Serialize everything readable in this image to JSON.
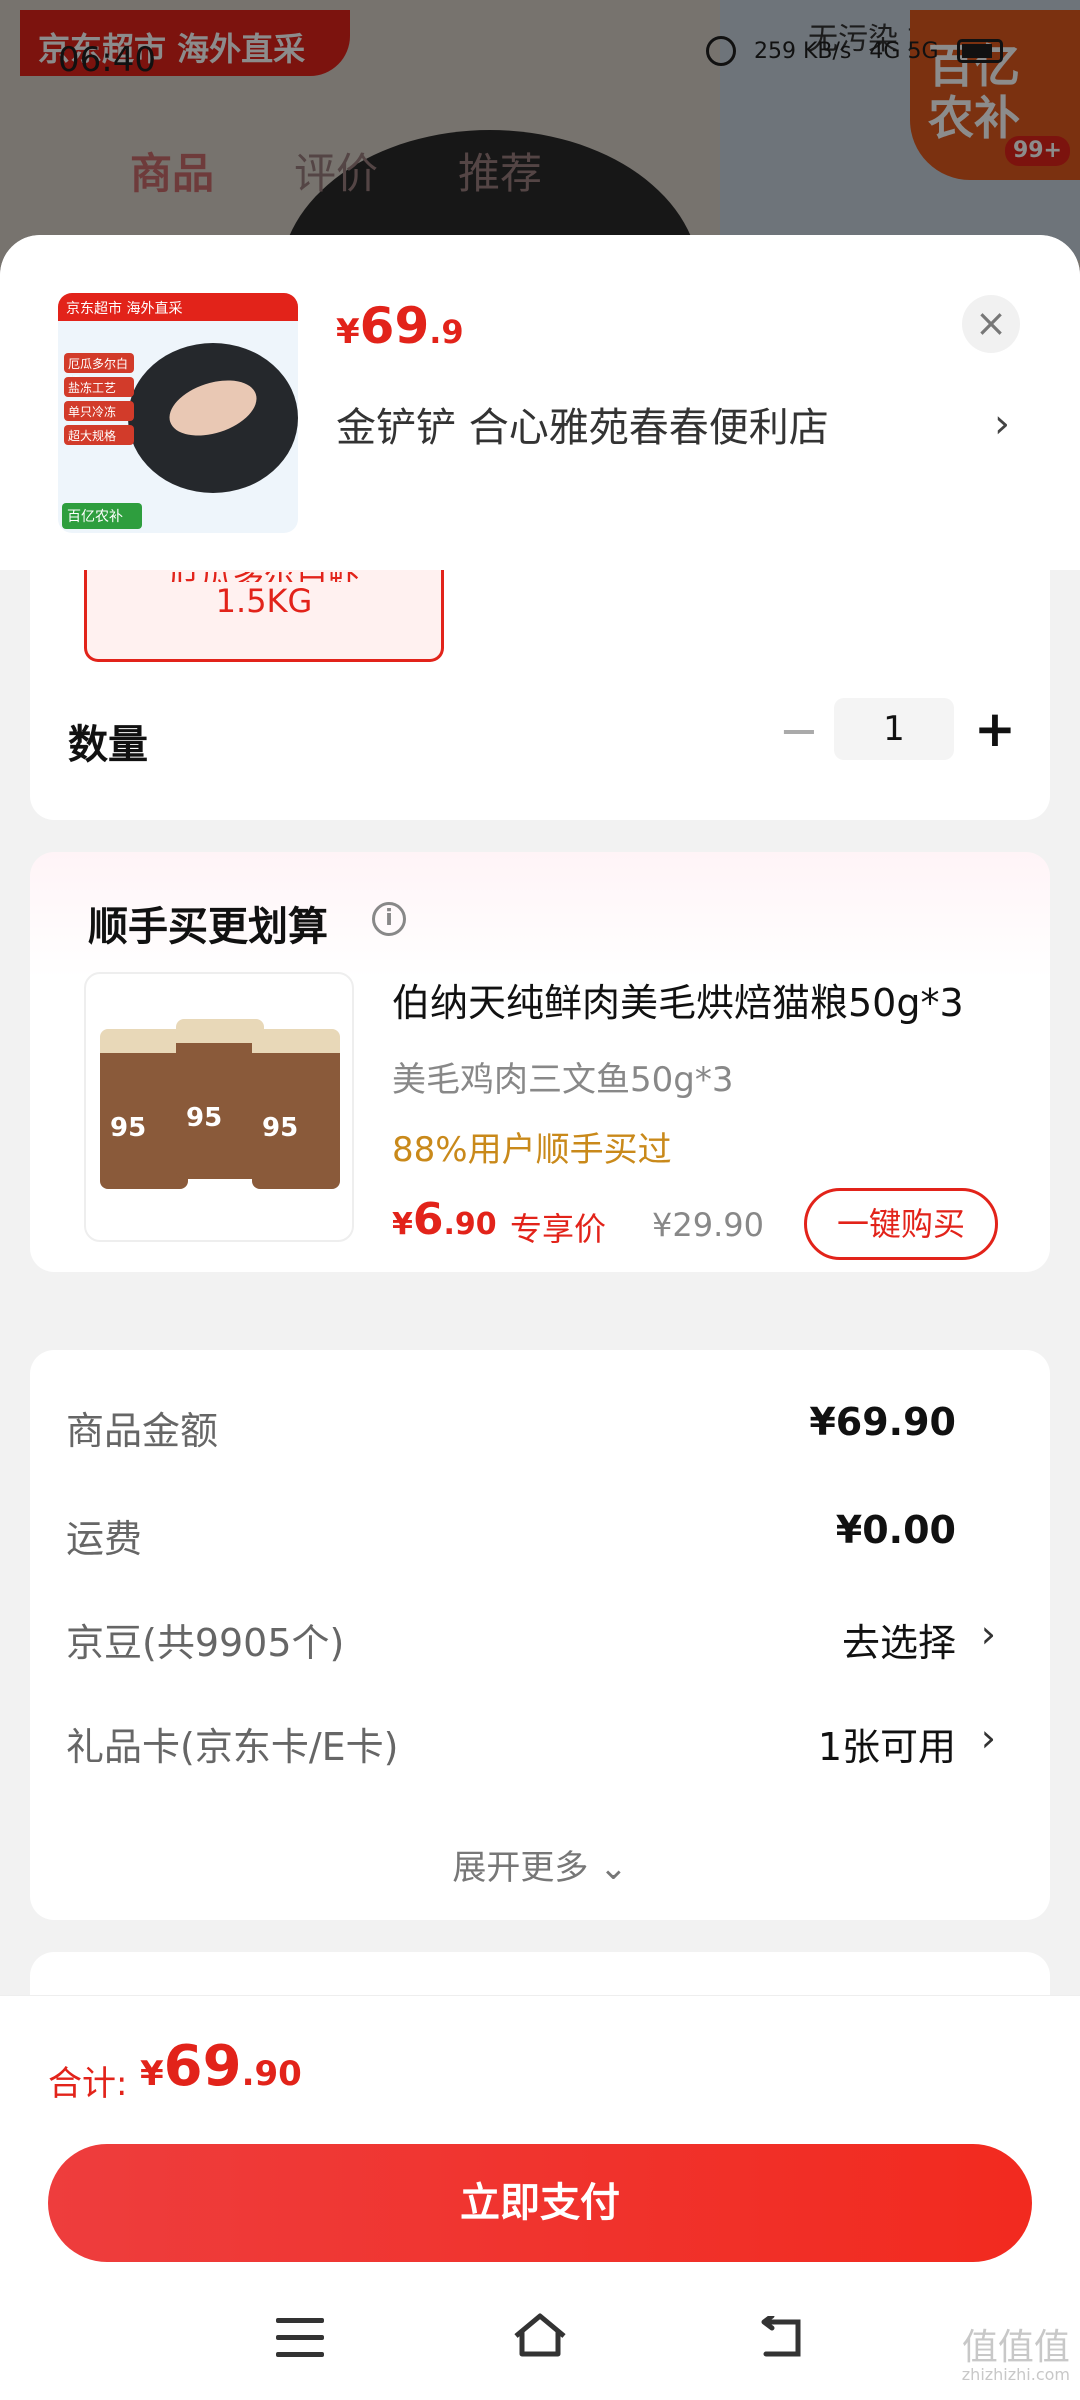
{
  "status_bar": {
    "time": "06:40",
    "net_speed": "259",
    "net_unit": "KB/s",
    "net_types": "4G 5G"
  },
  "background": {
    "banner": "京东超市 海外直采",
    "tabs": [
      "商品",
      "评价",
      "推荐"
    ],
    "right_text": "无污染 放",
    "logo_text": "百亿农补",
    "logo_badge": "99+"
  },
  "sheet": {
    "product_price": {
      "symbol": "¥",
      "int": "69",
      "dec": ".9"
    },
    "store_name": "金铲铲  合心雅苑春春便利店",
    "thumb_top": "京东超市 海外直采",
    "thumb_tags": [
      "厄瓜多尔白虾",
      "盐冻工艺",
      "单只冷冻",
      "超大规格"
    ],
    "thumb_logo": "百亿农补",
    "variant_cut": "厄瓜多尔白虾",
    "variant_label": "1.5KG",
    "quantity_label": "数量",
    "quantity_value": "1"
  },
  "upsell": {
    "title": "顺手买更划算",
    "name": "伯纳天纯鲜肉美毛烘焙猫粮50g*3",
    "spec": "美毛鸡肉三文鱼50g*3",
    "stat": "88%用户顺手买过",
    "price": {
      "symbol": "¥",
      "int": "6",
      "dec": ".90"
    },
    "price_tag": "专享价",
    "original_price": "¥29.90",
    "buy_button": "一键购买",
    "bag_label": "95"
  },
  "summary": {
    "rows": [
      {
        "label": "商品金额",
        "value": "¥69.90"
      },
      {
        "label": "运费",
        "value": "¥0.00"
      },
      {
        "label": "京豆(共9905个)",
        "value": "去选择"
      },
      {
        "label": "礼品卡(京东卡/E卡)",
        "value": "1张可用"
      }
    ],
    "expand": "展开更多"
  },
  "footer": {
    "total_label": "合计:",
    "total_price": {
      "symbol": "¥",
      "int": "69",
      "dec": ".90"
    },
    "pay_button": "立即支付"
  },
  "watermark": {
    "title": "值值值",
    "url": "zhizhizhi.com"
  },
  "colors": {
    "accent": "#e2231a",
    "gold": "#c9891a"
  }
}
